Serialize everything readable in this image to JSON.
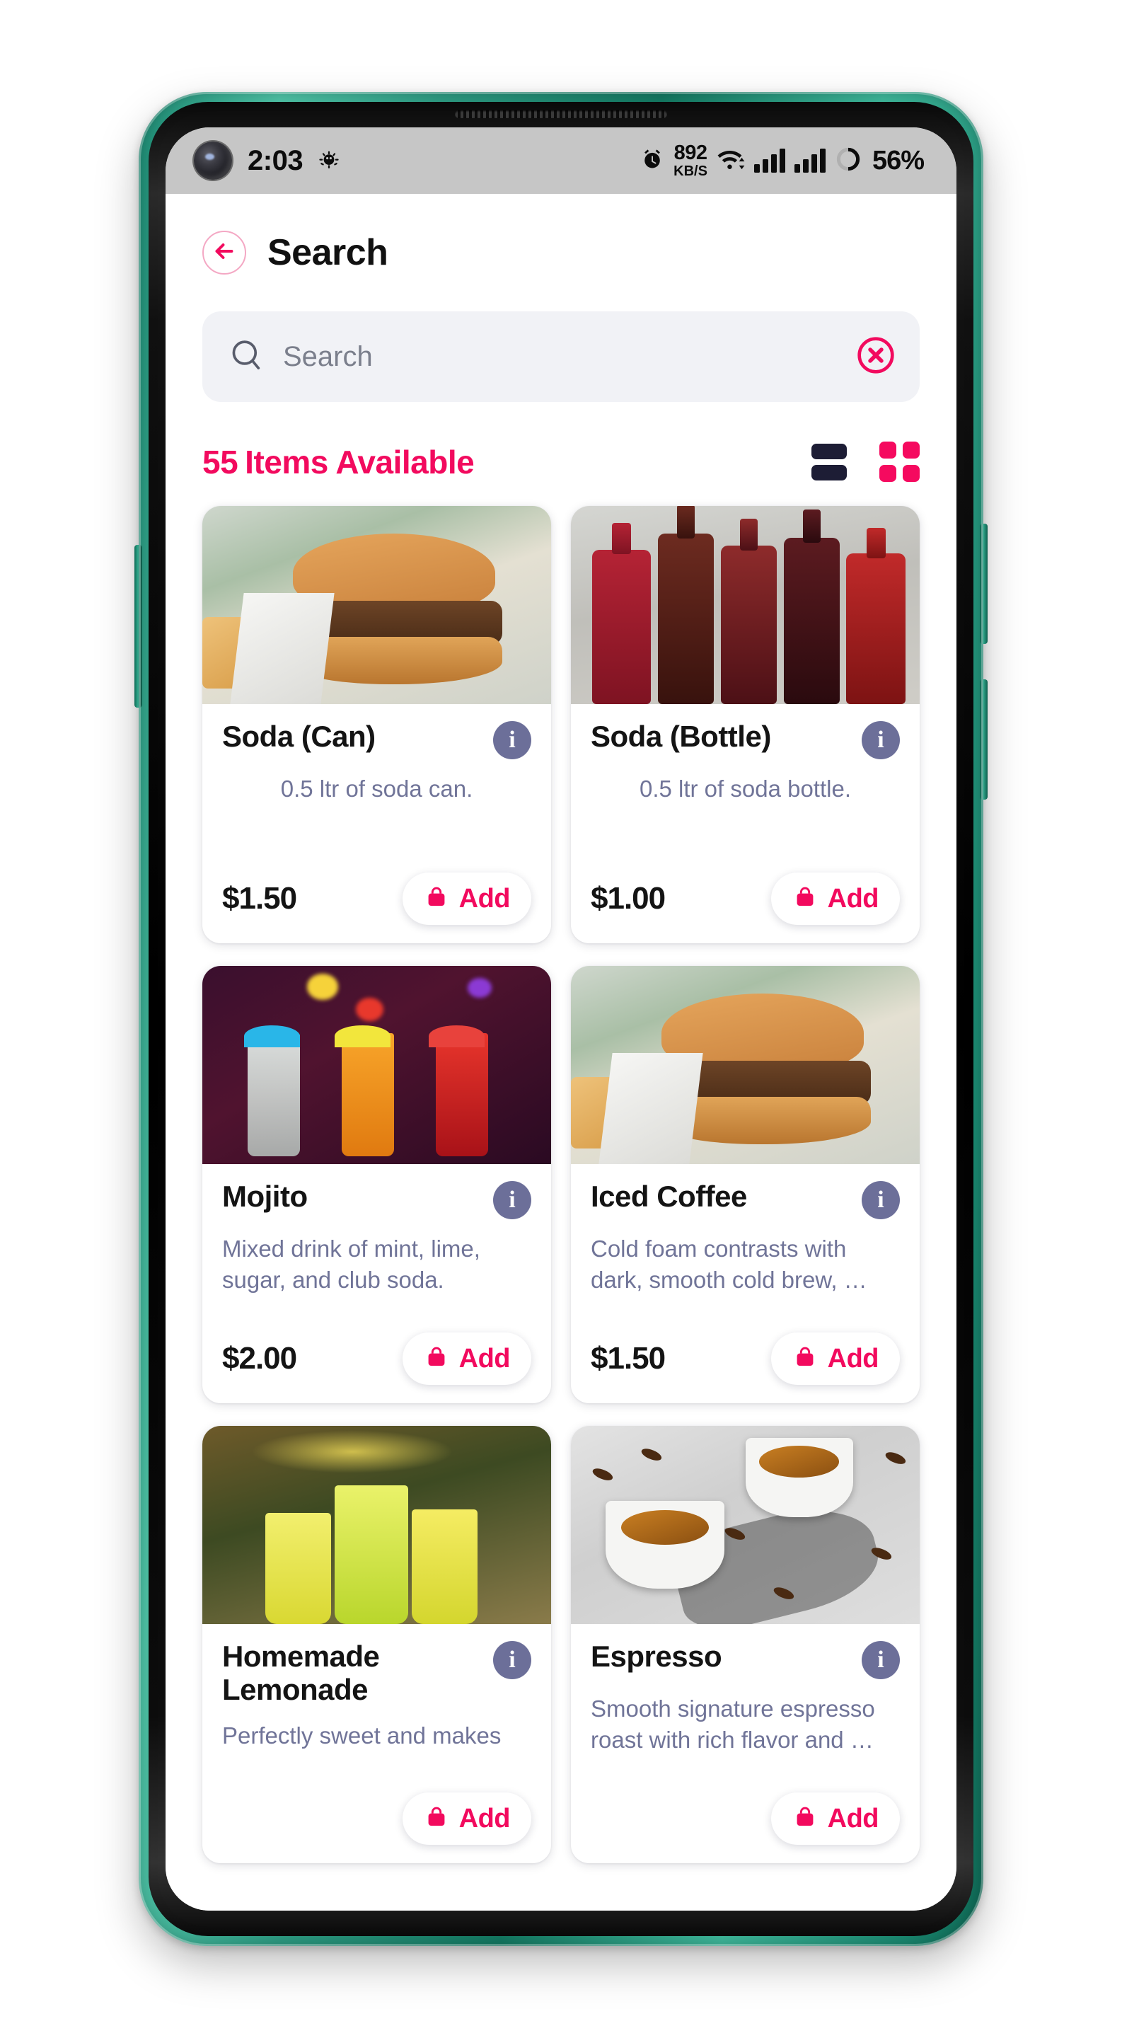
{
  "status_bar": {
    "time": "2:03",
    "net_speed_value": "892",
    "net_speed_unit": "KB/S",
    "battery": "56%",
    "icons": [
      "punch-hole-camera",
      "bug-icon",
      "alarm-icon",
      "wifi-icon",
      "signal-icon",
      "signal-icon",
      "battery-icon"
    ]
  },
  "appbar": {
    "title": "Search",
    "back_icon": "arrow-left-icon"
  },
  "search": {
    "placeholder": "Search",
    "value": "",
    "search_icon": "search-icon",
    "clear_icon": "close-circle-icon"
  },
  "list_header": {
    "count": "55",
    "label": "Items Available",
    "list_view_icon": "list-view-icon",
    "grid_view_icon": "grid-view-icon",
    "active_view": "grid"
  },
  "colors": {
    "accent_pink": "#f20a5e",
    "dark_navy": "#1d1d35",
    "info_slate": "#6c6f99",
    "desc_gray": "#707498",
    "search_bg": "#f1f2f6",
    "phone_bezel": "#2e9d84",
    "status_bar_bg": "#c6c6c6"
  },
  "products": [
    {
      "name": "Soda (Can)",
      "description": "0.5 ltr of soda can.",
      "price": "$1.50",
      "add_label": "Add",
      "info_icon": "info-icon",
      "bag_icon": "shopping-bag-icon",
      "image": "burger-sandwich",
      "desc_align": "center"
    },
    {
      "name": "Soda (Bottle)",
      "description": "0.5 ltr of soda bottle.",
      "price": "$1.00",
      "add_label": "Add",
      "info_icon": "info-icon",
      "bag_icon": "shopping-bag-icon",
      "image": "soda-bottles",
      "desc_align": "center"
    },
    {
      "name": "Mojito",
      "description": "Mixed drink of mint, lime, sugar, and club soda.",
      "price": "$2.00",
      "add_label": "Add",
      "info_icon": "info-icon",
      "bag_icon": "shopping-bag-icon",
      "image": "cocktails",
      "desc_align": "left"
    },
    {
      "name": "Iced Coffee",
      "description": "Cold foam contrasts with dark, smooth cold brew, …",
      "price": "$1.50",
      "add_label": "Add",
      "info_icon": "info-icon",
      "bag_icon": "shopping-bag-icon",
      "image": "burger-sandwich",
      "desc_align": "left"
    },
    {
      "name": "Homemade Lemonade",
      "description": "Perfectly sweet and makes",
      "price": "",
      "add_label": "Add",
      "info_icon": "info-icon",
      "bag_icon": "shopping-bag-icon",
      "image": "lemonade-cups",
      "desc_align": "left"
    },
    {
      "name": "Espresso",
      "description": "Smooth signature espresso roast with rich flavor and …",
      "price": "",
      "add_label": "Add",
      "info_icon": "info-icon",
      "bag_icon": "shopping-bag-icon",
      "image": "espresso-cups",
      "desc_align": "left"
    }
  ]
}
